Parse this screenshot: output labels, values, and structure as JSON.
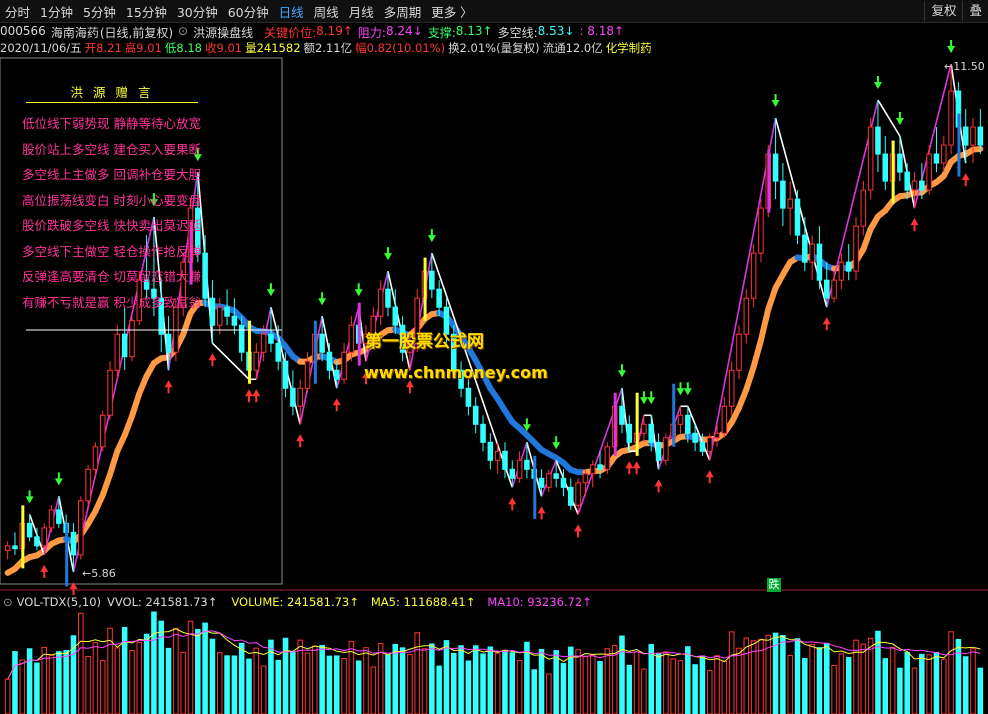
{
  "toolbar": {
    "periods": [
      "分时",
      "1分钟",
      "5分钟",
      "15分钟",
      "30分钟",
      "60分钟",
      "日线",
      "周线",
      "月线",
      "多周期",
      "更多 〉"
    ],
    "active": "日线",
    "right_buttons": [
      "复权",
      "叠"
    ]
  },
  "header": {
    "code": "000566",
    "name": "海南海药",
    "mode": "(日线,前复权)",
    "indicator": "洪源操盘线",
    "key_price_label": "关键价位:",
    "key_price": "8.19↑",
    "resistance_label": "阻力:",
    "resistance": "8.24↓",
    "support_label": "支撑:",
    "support": "8.13↑",
    "bull_label": "多空线:",
    "bull": "8.53↓",
    "extra": ": 8.18↑"
  },
  "quote": {
    "date": "2020/11/06/五",
    "open": "开8.21",
    "high": "高9.01",
    "low": "低8.18",
    "close": "收9.01",
    "volume": "量241582",
    "amount": "额2.11亿",
    "change": "幅0.82(10.01%)",
    "turnover": "换2.01%(量复权)",
    "float": "流通12.0亿",
    "sector": "化学制药"
  },
  "legend": {
    "title": "洪  源  赠  言",
    "lines": [
      "低位线下弱势现 静静等待心放宽",
      "股价站上多空线 建仓买入要果断",
      "多空线上主做多 回调补仓要大胆",
      "高位振荡线变白 时刻小心要变盘",
      "股价跌破多空线 快快卖出莫迟延",
      "多空线下主做空 轻仓操作抢反弹",
      "反弹逢高要清仓 切莫留恋错大赚",
      "有赚不亏就是赢 积少成多致富翁"
    ]
  },
  "price_labels": {
    "low": "←5.86",
    "high": "←11.50"
  },
  "watermark": {
    "cn": "第一股票公式网",
    "url": "www.chnmoney.com"
  },
  "badge": "跌",
  "vol": {
    "name": "VOL-TDX(5,10)",
    "vvol": "VVOL: 241581.73↑",
    "volume": "VOLUME: 241581.73↑",
    "ma5": "MA5: 111688.41↑",
    "ma10": "MA10: 93236.72↑"
  },
  "colors": {
    "up": "#ff3333",
    "down": "#33ffff",
    "key": "#ff3333",
    "resist": "#ff44ff",
    "support": "#33ff66",
    "bull": "#33ffff",
    "extra": "#ff44ff",
    "yellow": "#ffff33",
    "orange": "#ff9944",
    "blue": "#2277dd",
    "magenta": "#dd33dd"
  },
  "chart_data": {
    "type": "candlestick",
    "price_range": [
      5.86,
      11.5
    ],
    "candles": [
      [
        6.1,
        6.2,
        6.0,
        6.15
      ],
      [
        6.15,
        6.3,
        6.05,
        6.12
      ],
      [
        6.12,
        6.45,
        6.1,
        6.4
      ],
      [
        6.4,
        6.5,
        6.2,
        6.25
      ],
      [
        6.25,
        6.35,
        6.1,
        6.15
      ],
      [
        6.15,
        6.4,
        6.05,
        6.35
      ],
      [
        6.35,
        6.6,
        6.3,
        6.55
      ],
      [
        6.55,
        6.7,
        6.35,
        6.4
      ],
      [
        6.4,
        6.5,
        6.2,
        6.3
      ],
      [
        6.3,
        6.4,
        5.86,
        6.05
      ],
      [
        6.05,
        6.7,
        6.0,
        6.65
      ],
      [
        6.65,
        7.05,
        6.6,
        7.0
      ],
      [
        7.0,
        7.3,
        6.9,
        7.25
      ],
      [
        7.25,
        7.65,
        7.2,
        7.6
      ],
      [
        7.6,
        8.2,
        7.55,
        8.1
      ],
      [
        8.1,
        8.6,
        8.0,
        8.5
      ],
      [
        8.5,
        8.8,
        8.1,
        8.25
      ],
      [
        8.25,
        8.7,
        8.2,
        8.65
      ],
      [
        8.65,
        9.2,
        8.6,
        9.1
      ],
      [
        9.1,
        9.6,
        8.9,
        9.0
      ],
      [
        9.0,
        9.8,
        8.7,
        8.9
      ],
      [
        8.9,
        9.1,
        8.3,
        8.5
      ],
      [
        8.5,
        8.7,
        8.1,
        8.3
      ],
      [
        8.3,
        8.9,
        8.2,
        8.8
      ],
      [
        8.8,
        9.4,
        8.7,
        9.3
      ],
      [
        9.3,
        10.0,
        9.1,
        9.9
      ],
      [
        9.9,
        10.3,
        9.3,
        9.4
      ],
      [
        9.4,
        9.6,
        8.8,
        8.9
      ],
      [
        8.9,
        9.1,
        8.4,
        8.6
      ],
      [
        8.6,
        8.9,
        8.5,
        8.8
      ],
      [
        8.8,
        9.0,
        8.6,
        8.7
      ],
      [
        8.7,
        8.9,
        8.5,
        8.6
      ],
      [
        8.6,
        8.7,
        8.2,
        8.3
      ],
      [
        8.3,
        8.4,
        8.0,
        8.1
      ],
      [
        8.1,
        8.4,
        8.0,
        8.3
      ],
      [
        8.3,
        8.6,
        8.2,
        8.5
      ],
      [
        8.5,
        8.8,
        8.3,
        8.4
      ],
      [
        8.4,
        8.6,
        8.1,
        8.2
      ],
      [
        8.2,
        8.3,
        7.8,
        7.9
      ],
      [
        7.9,
        8.1,
        7.6,
        7.7
      ],
      [
        7.7,
        8.0,
        7.5,
        7.9
      ],
      [
        7.9,
        8.3,
        7.85,
        8.2
      ],
      [
        8.2,
        8.6,
        8.1,
        8.5
      ],
      [
        8.5,
        8.7,
        8.2,
        8.3
      ],
      [
        8.3,
        8.4,
        8.0,
        8.1
      ],
      [
        8.1,
        8.2,
        7.9,
        8.0
      ],
      [
        8.0,
        8.4,
        7.95,
        8.3
      ],
      [
        8.3,
        8.7,
        8.2,
        8.6
      ],
      [
        8.6,
        8.8,
        8.3,
        8.4
      ],
      [
        8.4,
        8.6,
        8.2,
        8.5
      ],
      [
        8.5,
        8.8,
        8.4,
        8.7
      ],
      [
        8.7,
        9.1,
        8.6,
        9.0
      ],
      [
        9.0,
        9.2,
        8.7,
        8.8
      ],
      [
        8.8,
        9.0,
        8.5,
        8.6
      ],
      [
        8.6,
        8.7,
        8.2,
        8.3
      ],
      [
        8.3,
        8.5,
        8.1,
        8.4
      ],
      [
        8.4,
        9.0,
        8.3,
        8.9
      ],
      [
        8.9,
        9.3,
        8.7,
        9.2
      ],
      [
        9.2,
        9.4,
        8.9,
        9.0
      ],
      [
        9.0,
        9.1,
        8.7,
        8.8
      ],
      [
        8.8,
        8.9,
        8.4,
        8.5
      ],
      [
        8.5,
        8.6,
        8.0,
        8.1
      ],
      [
        8.1,
        8.2,
        7.8,
        7.9
      ],
      [
        7.9,
        8.0,
        7.6,
        7.7
      ],
      [
        7.7,
        7.8,
        7.4,
        7.5
      ],
      [
        7.5,
        7.6,
        7.2,
        7.3
      ],
      [
        7.3,
        7.4,
        7.0,
        7.1
      ],
      [
        7.1,
        7.3,
        6.95,
        7.2
      ],
      [
        7.2,
        7.3,
        6.9,
        7.0
      ],
      [
        7.0,
        7.1,
        6.8,
        6.9
      ],
      [
        6.9,
        7.2,
        6.85,
        7.1
      ],
      [
        7.1,
        7.3,
        6.9,
        7.0
      ],
      [
        7.0,
        7.1,
        6.8,
        6.9
      ],
      [
        6.9,
        7.0,
        6.7,
        6.8
      ],
      [
        6.8,
        7.0,
        6.75,
        6.95
      ],
      [
        6.95,
        7.1,
        6.8,
        6.9
      ],
      [
        6.9,
        7.0,
        6.7,
        6.8
      ],
      [
        6.8,
        6.9,
        6.55,
        6.6
      ],
      [
        6.6,
        6.9,
        6.5,
        6.85
      ],
      [
        6.85,
        7.0,
        6.7,
        6.95
      ],
      [
        6.95,
        7.1,
        6.8,
        7.05
      ],
      [
        7.05,
        7.2,
        6.9,
        7.0
      ],
      [
        7.0,
        7.3,
        6.95,
        7.25
      ],
      [
        7.25,
        7.8,
        7.2,
        7.7
      ],
      [
        7.7,
        7.9,
        7.4,
        7.5
      ],
      [
        7.5,
        7.6,
        7.2,
        7.3
      ],
      [
        7.3,
        7.5,
        7.2,
        7.4
      ],
      [
        7.4,
        7.6,
        7.3,
        7.5
      ],
      [
        7.5,
        7.6,
        7.2,
        7.3
      ],
      [
        7.3,
        7.4,
        7.0,
        7.1
      ],
      [
        7.1,
        7.4,
        7.05,
        7.35
      ],
      [
        7.35,
        7.6,
        7.3,
        7.5
      ],
      [
        7.5,
        7.7,
        7.4,
        7.6
      ],
      [
        7.6,
        7.7,
        7.3,
        7.4
      ],
      [
        7.4,
        7.5,
        7.2,
        7.3
      ],
      [
        7.3,
        7.4,
        7.15,
        7.2
      ],
      [
        7.2,
        7.4,
        7.1,
        7.35
      ],
      [
        7.35,
        7.5,
        7.25,
        7.4
      ],
      [
        7.4,
        7.8,
        7.35,
        7.7
      ],
      [
        7.7,
        8.2,
        7.6,
        8.1
      ],
      [
        8.1,
        8.6,
        8.0,
        8.5
      ],
      [
        8.5,
        9.0,
        8.4,
        8.9
      ],
      [
        8.9,
        9.5,
        8.8,
        9.4
      ],
      [
        9.4,
        10.0,
        9.3,
        9.9
      ],
      [
        9.9,
        10.6,
        9.8,
        10.5
      ],
      [
        10.5,
        10.9,
        10.0,
        10.2
      ],
      [
        10.2,
        10.4,
        9.7,
        9.9
      ],
      [
        9.9,
        10.2,
        9.6,
        10.0
      ],
      [
        10.0,
        10.1,
        9.5,
        9.6
      ],
      [
        9.6,
        9.8,
        9.2,
        9.3
      ],
      [
        9.3,
        9.6,
        9.1,
        9.5
      ],
      [
        9.5,
        9.7,
        9.0,
        9.1
      ],
      [
        9.1,
        9.3,
        8.8,
        8.9
      ],
      [
        8.9,
        9.2,
        8.85,
        9.1
      ],
      [
        9.1,
        9.4,
        9.0,
        9.3
      ],
      [
        9.3,
        9.5,
        9.1,
        9.2
      ],
      [
        9.2,
        9.8,
        9.1,
        9.7
      ],
      [
        9.7,
        10.2,
        9.6,
        10.1
      ],
      [
        10.1,
        10.9,
        10.0,
        10.8
      ],
      [
        10.8,
        11.1,
        10.3,
        10.5
      ],
      [
        10.5,
        10.7,
        10.1,
        10.2
      ],
      [
        10.2,
        10.6,
        10.1,
        10.5
      ],
      [
        10.5,
        10.7,
        10.2,
        10.3
      ],
      [
        10.3,
        10.4,
        10.0,
        10.1
      ],
      [
        10.1,
        10.3,
        9.9,
        10.2
      ],
      [
        10.2,
        10.4,
        10.0,
        10.1
      ],
      [
        10.1,
        10.6,
        10.05,
        10.5
      ],
      [
        10.5,
        10.8,
        10.3,
        10.4
      ],
      [
        10.4,
        10.7,
        10.3,
        10.6
      ],
      [
        10.6,
        11.5,
        10.5,
        11.2
      ],
      [
        11.2,
        11.3,
        10.6,
        10.8
      ],
      [
        10.8,
        11.0,
        10.4,
        10.6
      ],
      [
        10.6,
        10.9,
        10.4,
        10.8
      ],
      [
        10.8,
        11.0,
        10.5,
        10.6
      ]
    ]
  }
}
